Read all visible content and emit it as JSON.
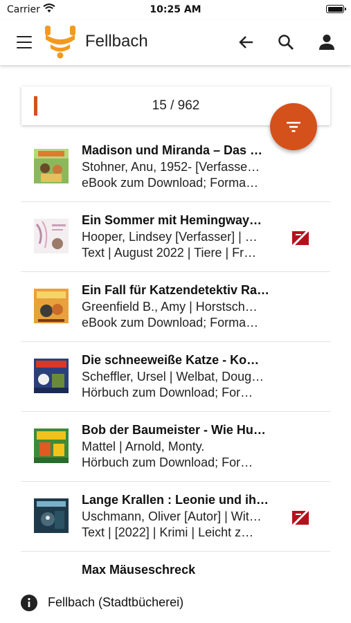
{
  "status_bar": {
    "carrier": "Carrier",
    "time": "10:25 AM"
  },
  "app_bar": {
    "title": "Fellbach",
    "icons": [
      "menu-icon",
      "back-arrow-icon",
      "search-icon",
      "account-icon"
    ]
  },
  "results": {
    "counter": "15 / 962"
  },
  "colors": {
    "accent": "#d4511c",
    "logo": "#f39a1e",
    "unavailable": "#b3121c"
  },
  "items": [
    {
      "title": "Madison und Miranda – Das …",
      "author": "Stohner, Anu, 1952- [Verfasse…",
      "format": "eBook zum Download; Forma…",
      "unavailable": false
    },
    {
      "title": "Ein Sommer mit Hemingway…",
      "author": "Hooper, Lindsey [Verfasser] | …",
      "format": "Text | August 2022 | Tiere | Fr…",
      "unavailable": true
    },
    {
      "title": "Ein Fall für Katzendetektiv Ra…",
      "author": "Greenfield B., Amy | Horstsch…",
      "format": "eBook zum Download; Forma…",
      "unavailable": false
    },
    {
      "title": "Die schneeweiße Katze - Ko…",
      "author": "Scheffler, Ursel | Welbat, Doug…",
      "format": "Hörbuch zum Download; For…",
      "unavailable": false
    },
    {
      "title": "Bob der Baumeister - Wie Hu…",
      "author": "Mattel | Arnold, Monty.",
      "format": "Hörbuch zum Download; For…",
      "unavailable": false
    },
    {
      "title": "Lange Krallen : Leonie und ih…",
      "author": "Uschmann, Oliver [Autor] | Wit…",
      "format": "Text | [2022] | Krimi | Leicht z…",
      "unavailable": true
    },
    {
      "title": "Max Mäuseschreck",
      "author": "",
      "format": "",
      "unavailable": true
    }
  ],
  "bottom_bar": {
    "library": "Fellbach (Stadtbücherei)"
  }
}
